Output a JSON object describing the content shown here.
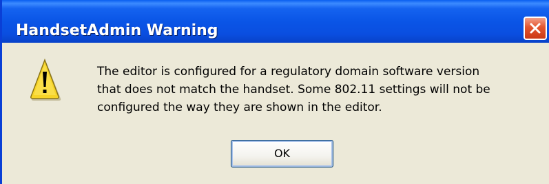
{
  "window": {
    "title": "HandsetAdmin Warning",
    "close_icon": "close-icon"
  },
  "content": {
    "icon": "warning-icon",
    "message_lines": [
      "The editor is configured for a regulatory domain software version",
      "that does not match the handset.  Some 802.11 settings will not be",
      "configured the way they are shown in the editor."
    ]
  },
  "buttons": {
    "ok_label": "OK"
  }
}
